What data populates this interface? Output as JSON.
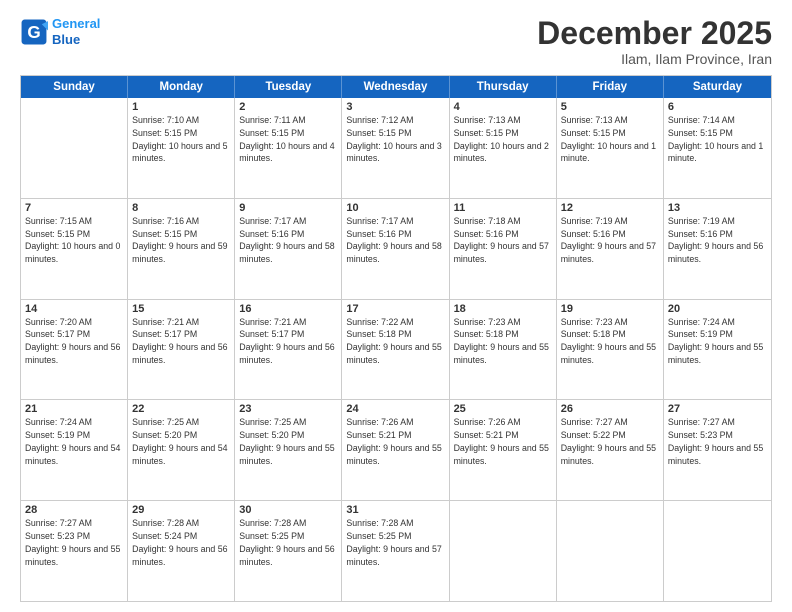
{
  "logo": {
    "line1": "General",
    "line2": "Blue"
  },
  "title": "December 2025",
  "subtitle": "Ilam, Ilam Province, Iran",
  "headers": [
    "Sunday",
    "Monday",
    "Tuesday",
    "Wednesday",
    "Thursday",
    "Friday",
    "Saturday"
  ],
  "weeks": [
    [
      {
        "day": "",
        "sunrise": "",
        "sunset": "",
        "daylight": "",
        "empty": true
      },
      {
        "day": "1",
        "sunrise": "Sunrise: 7:10 AM",
        "sunset": "Sunset: 5:15 PM",
        "daylight": "Daylight: 10 hours and 5 minutes."
      },
      {
        "day": "2",
        "sunrise": "Sunrise: 7:11 AM",
        "sunset": "Sunset: 5:15 PM",
        "daylight": "Daylight: 10 hours and 4 minutes."
      },
      {
        "day": "3",
        "sunrise": "Sunrise: 7:12 AM",
        "sunset": "Sunset: 5:15 PM",
        "daylight": "Daylight: 10 hours and 3 minutes."
      },
      {
        "day": "4",
        "sunrise": "Sunrise: 7:13 AM",
        "sunset": "Sunset: 5:15 PM",
        "daylight": "Daylight: 10 hours and 2 minutes."
      },
      {
        "day": "5",
        "sunrise": "Sunrise: 7:13 AM",
        "sunset": "Sunset: 5:15 PM",
        "daylight": "Daylight: 10 hours and 1 minute."
      },
      {
        "day": "6",
        "sunrise": "Sunrise: 7:14 AM",
        "sunset": "Sunset: 5:15 PM",
        "daylight": "Daylight: 10 hours and 1 minute."
      }
    ],
    [
      {
        "day": "7",
        "sunrise": "Sunrise: 7:15 AM",
        "sunset": "Sunset: 5:15 PM",
        "daylight": "Daylight: 10 hours and 0 minutes."
      },
      {
        "day": "8",
        "sunrise": "Sunrise: 7:16 AM",
        "sunset": "Sunset: 5:15 PM",
        "daylight": "Daylight: 9 hours and 59 minutes."
      },
      {
        "day": "9",
        "sunrise": "Sunrise: 7:17 AM",
        "sunset": "Sunset: 5:16 PM",
        "daylight": "Daylight: 9 hours and 58 minutes."
      },
      {
        "day": "10",
        "sunrise": "Sunrise: 7:17 AM",
        "sunset": "Sunset: 5:16 PM",
        "daylight": "Daylight: 9 hours and 58 minutes."
      },
      {
        "day": "11",
        "sunrise": "Sunrise: 7:18 AM",
        "sunset": "Sunset: 5:16 PM",
        "daylight": "Daylight: 9 hours and 57 minutes."
      },
      {
        "day": "12",
        "sunrise": "Sunrise: 7:19 AM",
        "sunset": "Sunset: 5:16 PM",
        "daylight": "Daylight: 9 hours and 57 minutes."
      },
      {
        "day": "13",
        "sunrise": "Sunrise: 7:19 AM",
        "sunset": "Sunset: 5:16 PM",
        "daylight": "Daylight: 9 hours and 56 minutes."
      }
    ],
    [
      {
        "day": "14",
        "sunrise": "Sunrise: 7:20 AM",
        "sunset": "Sunset: 5:17 PM",
        "daylight": "Daylight: 9 hours and 56 minutes."
      },
      {
        "day": "15",
        "sunrise": "Sunrise: 7:21 AM",
        "sunset": "Sunset: 5:17 PM",
        "daylight": "Daylight: 9 hours and 56 minutes."
      },
      {
        "day": "16",
        "sunrise": "Sunrise: 7:21 AM",
        "sunset": "Sunset: 5:17 PM",
        "daylight": "Daylight: 9 hours and 56 minutes."
      },
      {
        "day": "17",
        "sunrise": "Sunrise: 7:22 AM",
        "sunset": "Sunset: 5:18 PM",
        "daylight": "Daylight: 9 hours and 55 minutes."
      },
      {
        "day": "18",
        "sunrise": "Sunrise: 7:23 AM",
        "sunset": "Sunset: 5:18 PM",
        "daylight": "Daylight: 9 hours and 55 minutes."
      },
      {
        "day": "19",
        "sunrise": "Sunrise: 7:23 AM",
        "sunset": "Sunset: 5:18 PM",
        "daylight": "Daylight: 9 hours and 55 minutes."
      },
      {
        "day": "20",
        "sunrise": "Sunrise: 7:24 AM",
        "sunset": "Sunset: 5:19 PM",
        "daylight": "Daylight: 9 hours and 55 minutes."
      }
    ],
    [
      {
        "day": "21",
        "sunrise": "Sunrise: 7:24 AM",
        "sunset": "Sunset: 5:19 PM",
        "daylight": "Daylight: 9 hours and 54 minutes."
      },
      {
        "day": "22",
        "sunrise": "Sunrise: 7:25 AM",
        "sunset": "Sunset: 5:20 PM",
        "daylight": "Daylight: 9 hours and 54 minutes."
      },
      {
        "day": "23",
        "sunrise": "Sunrise: 7:25 AM",
        "sunset": "Sunset: 5:20 PM",
        "daylight": "Daylight: 9 hours and 55 minutes."
      },
      {
        "day": "24",
        "sunrise": "Sunrise: 7:26 AM",
        "sunset": "Sunset: 5:21 PM",
        "daylight": "Daylight: 9 hours and 55 minutes."
      },
      {
        "day": "25",
        "sunrise": "Sunrise: 7:26 AM",
        "sunset": "Sunset: 5:21 PM",
        "daylight": "Daylight: 9 hours and 55 minutes."
      },
      {
        "day": "26",
        "sunrise": "Sunrise: 7:27 AM",
        "sunset": "Sunset: 5:22 PM",
        "daylight": "Daylight: 9 hours and 55 minutes."
      },
      {
        "day": "27",
        "sunrise": "Sunrise: 7:27 AM",
        "sunset": "Sunset: 5:23 PM",
        "daylight": "Daylight: 9 hours and 55 minutes."
      }
    ],
    [
      {
        "day": "28",
        "sunrise": "Sunrise: 7:27 AM",
        "sunset": "Sunset: 5:23 PM",
        "daylight": "Daylight: 9 hours and 55 minutes."
      },
      {
        "day": "29",
        "sunrise": "Sunrise: 7:28 AM",
        "sunset": "Sunset: 5:24 PM",
        "daylight": "Daylight: 9 hours and 56 minutes."
      },
      {
        "day": "30",
        "sunrise": "Sunrise: 7:28 AM",
        "sunset": "Sunset: 5:25 PM",
        "daylight": "Daylight: 9 hours and 56 minutes."
      },
      {
        "day": "31",
        "sunrise": "Sunrise: 7:28 AM",
        "sunset": "Sunset: 5:25 PM",
        "daylight": "Daylight: 9 hours and 57 minutes."
      },
      {
        "day": "",
        "empty": true
      },
      {
        "day": "",
        "empty": true
      },
      {
        "day": "",
        "empty": true
      }
    ]
  ]
}
